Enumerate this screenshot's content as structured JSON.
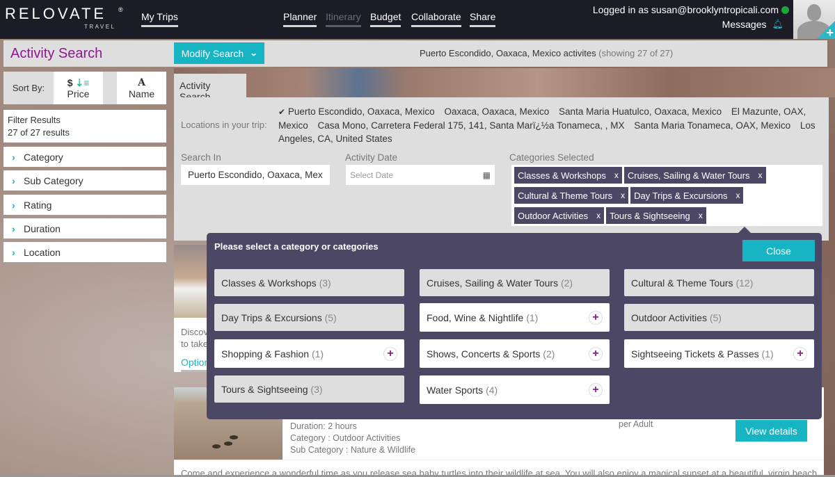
{
  "brand": {
    "name": "RELOVATE",
    "registered": "®",
    "subtitle": "TRAVEL"
  },
  "nav": {
    "my_trips": "My Trips",
    "links": [
      {
        "label": "Planner",
        "enabled": true
      },
      {
        "label": "Itinerary",
        "enabled": false
      },
      {
        "label": "Budget",
        "enabled": true
      },
      {
        "label": "Collaborate",
        "enabled": true
      },
      {
        "label": "Share",
        "enabled": true
      }
    ],
    "user": "Logged in as susan@brooklyntropicali.com",
    "messages": "Messages",
    "status": "online",
    "icons": {
      "status": "status-dot",
      "messages": "bell-icon",
      "avatar": "user-avatar",
      "add": "plus-icon"
    }
  },
  "header": {
    "title": "Activity Search",
    "modify_button": "Modify Search",
    "results_text": "Puerto Escondido, Oaxaca, Mexico activites",
    "results_count": "(showing 27 of 27)"
  },
  "sidebar": {
    "sort_label": "Sort By:",
    "sort_options": [
      {
        "label": "Price",
        "icon": "$",
        "icon2": "⇣≡"
      },
      {
        "label": "Name",
        "icon": "A"
      }
    ],
    "filter_title": "Filter Results",
    "filter_count": "27 of 27 results",
    "filters": [
      "Category",
      "Sub Category",
      "Rating",
      "Duration",
      "Location"
    ]
  },
  "search": {
    "tab_label": "Activity Search",
    "locations_label": "Locations in your trip:",
    "locations": [
      {
        "name": "Puerto Escondido, Oaxaca, Mexico",
        "selected": true
      },
      {
        "name": "Oaxaca, Oaxaca, Mexico",
        "selected": false
      },
      {
        "name": "Santa Maria Huatulco, Oaxaca, Mexico",
        "selected": false
      },
      {
        "name": "El Mazunte, OAX, Mexico",
        "selected": false
      },
      {
        "name": "Casa Mono, Carretera Federal 175, 141, Santa Marï¿½a Tonameca, , MX",
        "selected": false
      },
      {
        "name": "Santa Maria Tonameca, OAX, Mexico",
        "selected": false
      },
      {
        "name": "Los Angeles, CA, United States",
        "selected": false
      }
    ],
    "search_in_label": "Search In",
    "search_in_value": "Puerto Escondido, Oaxaca, Mexi",
    "date_label": "Activity Date",
    "date_placeholder": "Select Date",
    "categories_label": "Categories Selected",
    "selected_categories": [
      "Classes & Workshops",
      "Cruises, Sailing & Water Tours",
      "Cultural & Theme Tours",
      "Day Trips & Excursions",
      "Outdoor Activities",
      "Tours & Sightseeing"
    ],
    "remove_label": "x"
  },
  "popup": {
    "title": "Please select a category or categories",
    "close_label": "Close",
    "categories": [
      {
        "name": "Classes & Workshops",
        "count": "(3)",
        "selected": true
      },
      {
        "name": "Cruises, Sailing & Water Tours",
        "count": "(2)",
        "selected": true
      },
      {
        "name": "Cultural & Theme Tours",
        "count": "(12)",
        "selected": true
      },
      {
        "name": "Day Trips & Excursions",
        "count": "(5)",
        "selected": true
      },
      {
        "name": "Food, Wine & Nightlife",
        "count": "(1)",
        "selected": false
      },
      {
        "name": "Outdoor Activities",
        "count": "(5)",
        "selected": true
      },
      {
        "name": "Shopping & Fashion",
        "count": "(1)",
        "selected": false
      },
      {
        "name": "Shows, Concerts & Sports",
        "count": "(2)",
        "selected": false
      },
      {
        "name": "Sightseeing Tickets & Passes",
        "count": "(1)",
        "selected": false
      },
      {
        "name": "Tours & Sightseeing",
        "count": "(3)",
        "selected": true
      },
      {
        "name": "Water Sports",
        "count": "(4)",
        "selected": false
      }
    ],
    "add_label": "+"
  },
  "results": [
    {
      "desc_partial": "Discov",
      "desc_partial2": "to take",
      "options_partial": "Option"
    },
    {
      "duration": "Duration: 2 hours",
      "category": "Category : Outdoor Activities",
      "sub_category": "Sub Category : Nature & Wildlife",
      "price_unit": "per Adult",
      "view_button": "View details",
      "description": "Come and experience a wonderful time as you release sea baby turtles into their wildlife at sea. You will also enjoy a magical sunset at a beautiful, virgin beach. Come"
    }
  ]
}
